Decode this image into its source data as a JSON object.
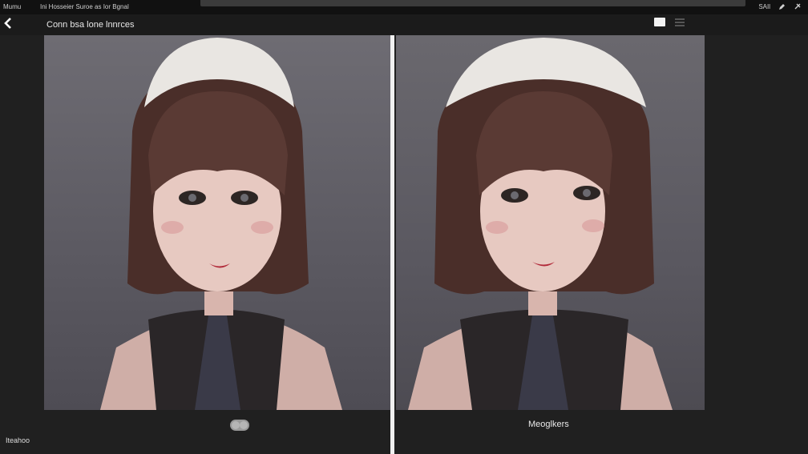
{
  "topbar": {
    "app_name": "Mumu",
    "url_text": "Ini Hosseier Suroe as Ior Bgnal",
    "right_label": "SAIl"
  },
  "header": {
    "title": "Conn bsa lone lnnrces"
  },
  "panels": {
    "left_alt": "Portrait of a girl with a bob haircut and white beret (original)",
    "right_alt": "Portrait of a girl with a bob haircut and white beret (result)"
  },
  "footer": {
    "left_label": "Iteahoo",
    "right_caption": "Meoglkers"
  },
  "colors": {
    "background": "#202020",
    "divider": "#f0f0f0",
    "panel_bg": "#5b5961"
  },
  "icons": {
    "back": "chevron-left-icon",
    "edit": "pencil-icon",
    "pin": "pin-icon",
    "view": "frame-icon",
    "menu": "menu-lines-icon",
    "toggle": "compare-toggle-icon"
  }
}
